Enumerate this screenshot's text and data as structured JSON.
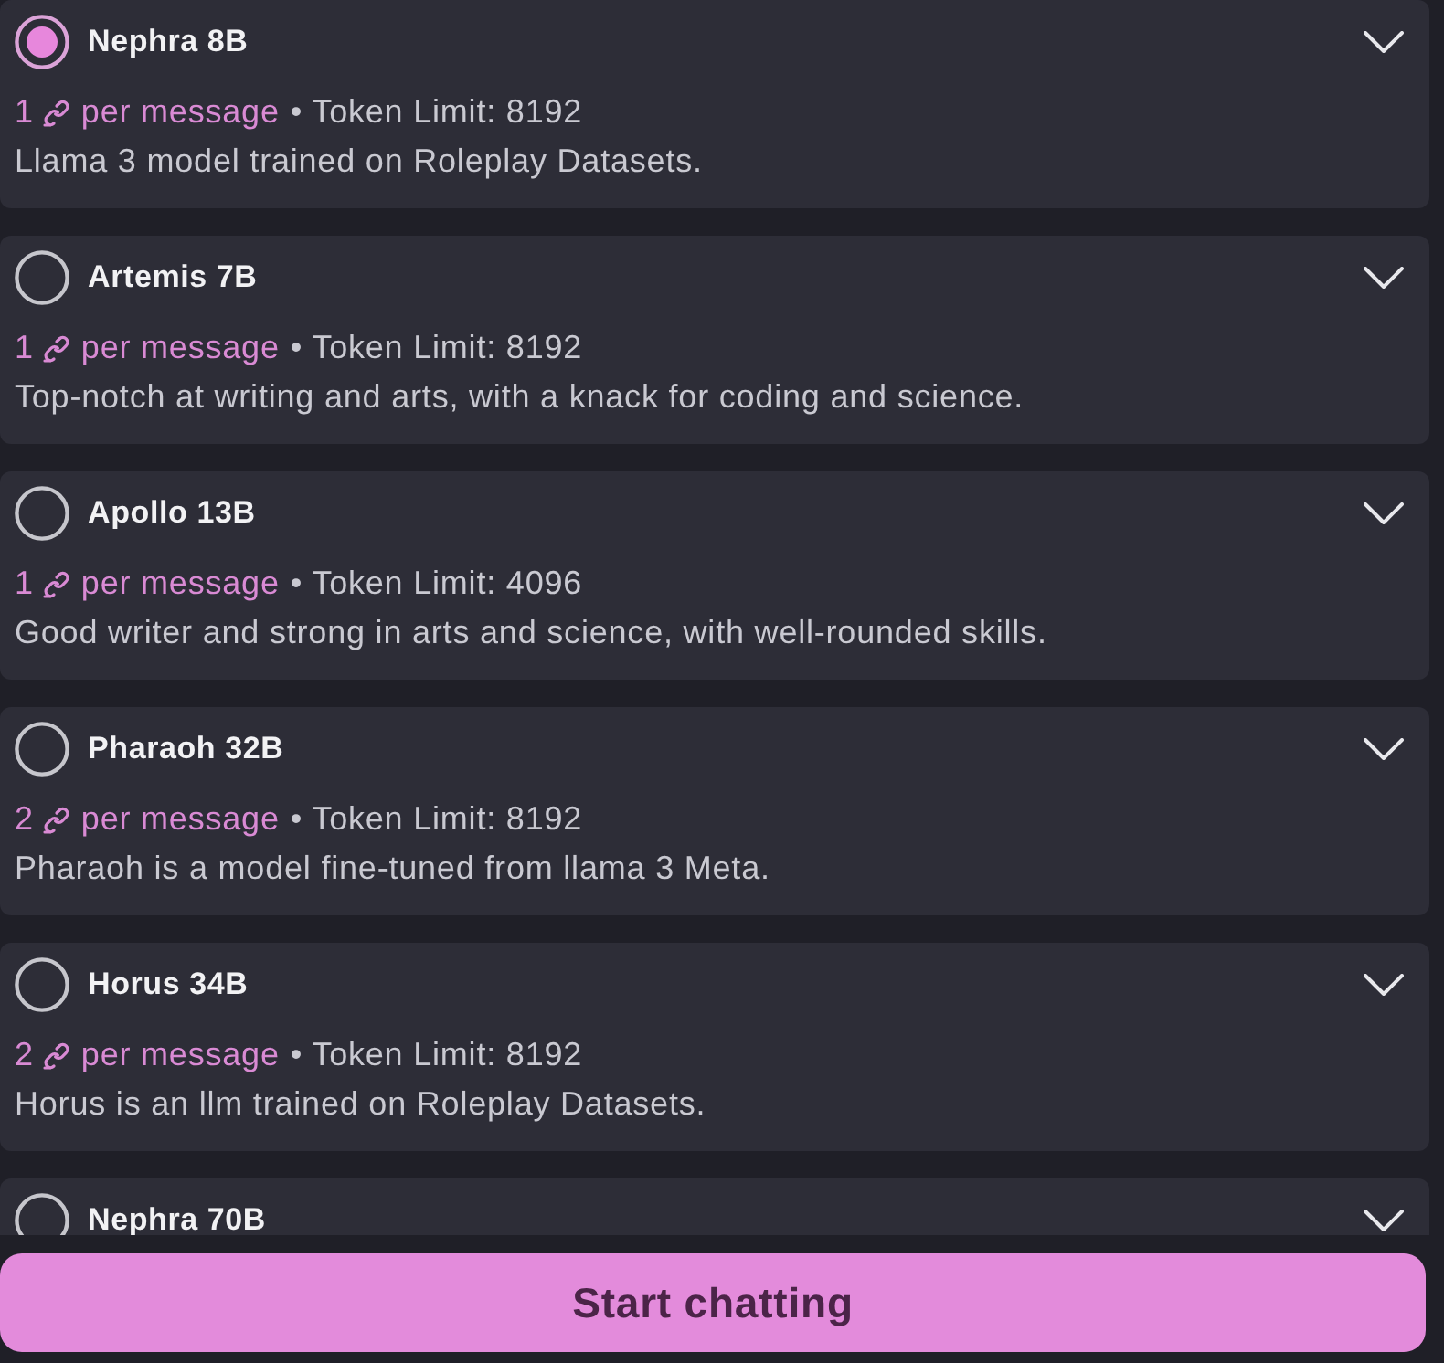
{
  "models": [
    {
      "name": "Nephra 8B",
      "selected": true,
      "cost": "1",
      "cost_label": "per message",
      "limit": "• Token Limit: 8192",
      "description": "Llama 3 model trained on Roleplay Datasets."
    },
    {
      "name": "Artemis 7B",
      "selected": false,
      "cost": "1",
      "cost_label": "per message",
      "limit": "• Token Limit: 8192",
      "description": "Top-notch at writing and arts, with a knack for coding and science."
    },
    {
      "name": "Apollo 13B",
      "selected": false,
      "cost": "1",
      "cost_label": "per message",
      "limit": "• Token Limit: 4096",
      "description": "Good writer and strong in arts and science, with well-rounded skills."
    },
    {
      "name": "Pharaoh 32B",
      "selected": false,
      "cost": "2",
      "cost_label": "per message",
      "limit": "• Token Limit: 8192",
      "description": "Pharaoh is a model fine-tuned from llama 3 Meta."
    },
    {
      "name": "Horus 34B",
      "selected": false,
      "cost": "2",
      "cost_label": "per message",
      "limit": "• Token Limit: 8192",
      "description": "Horus is an llm trained on Roleplay Datasets."
    },
    {
      "name": "Nephra 70B",
      "selected": false
    }
  ],
  "start_button": {
    "label": "Start chatting"
  }
}
